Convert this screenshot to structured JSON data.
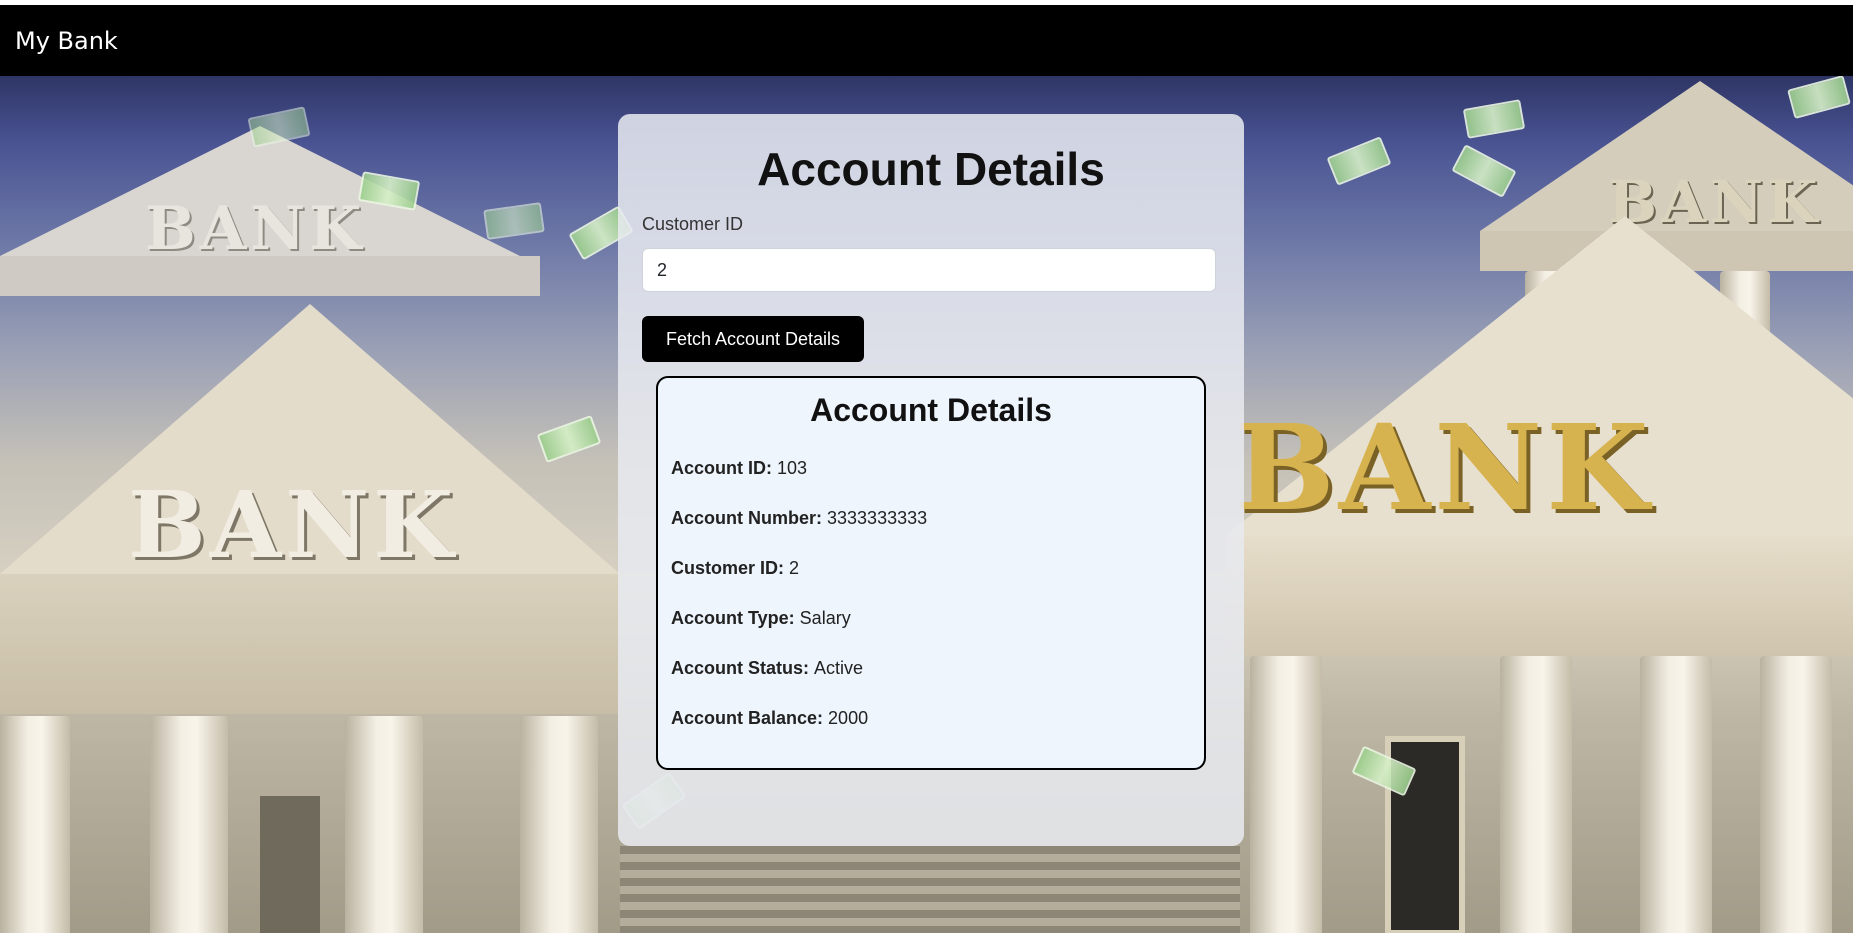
{
  "navbar": {
    "brand": "My Bank"
  },
  "hero": {
    "bank_words": [
      "BANK",
      "BANK",
      "BANK",
      "BANK",
      "BANK"
    ]
  },
  "form": {
    "title": "Account Details",
    "customer_id_label": "Customer ID",
    "customer_id_value": "2",
    "fetch_button": "Fetch Account Details"
  },
  "details": {
    "title": "Account Details",
    "rows": [
      {
        "label": "Account ID:",
        "value": "103"
      },
      {
        "label": "Account Number:",
        "value": "3333333333"
      },
      {
        "label": "Customer ID:",
        "value": "2"
      },
      {
        "label": "Account Type:",
        "value": "Salary"
      },
      {
        "label": "Account Status:",
        "value": "Active"
      },
      {
        "label": "Account Balance:",
        "value": "2000"
      }
    ]
  },
  "colors": {
    "navbar_bg": "#000000",
    "button_bg": "#000000",
    "details_bg": "#eef5fd"
  }
}
